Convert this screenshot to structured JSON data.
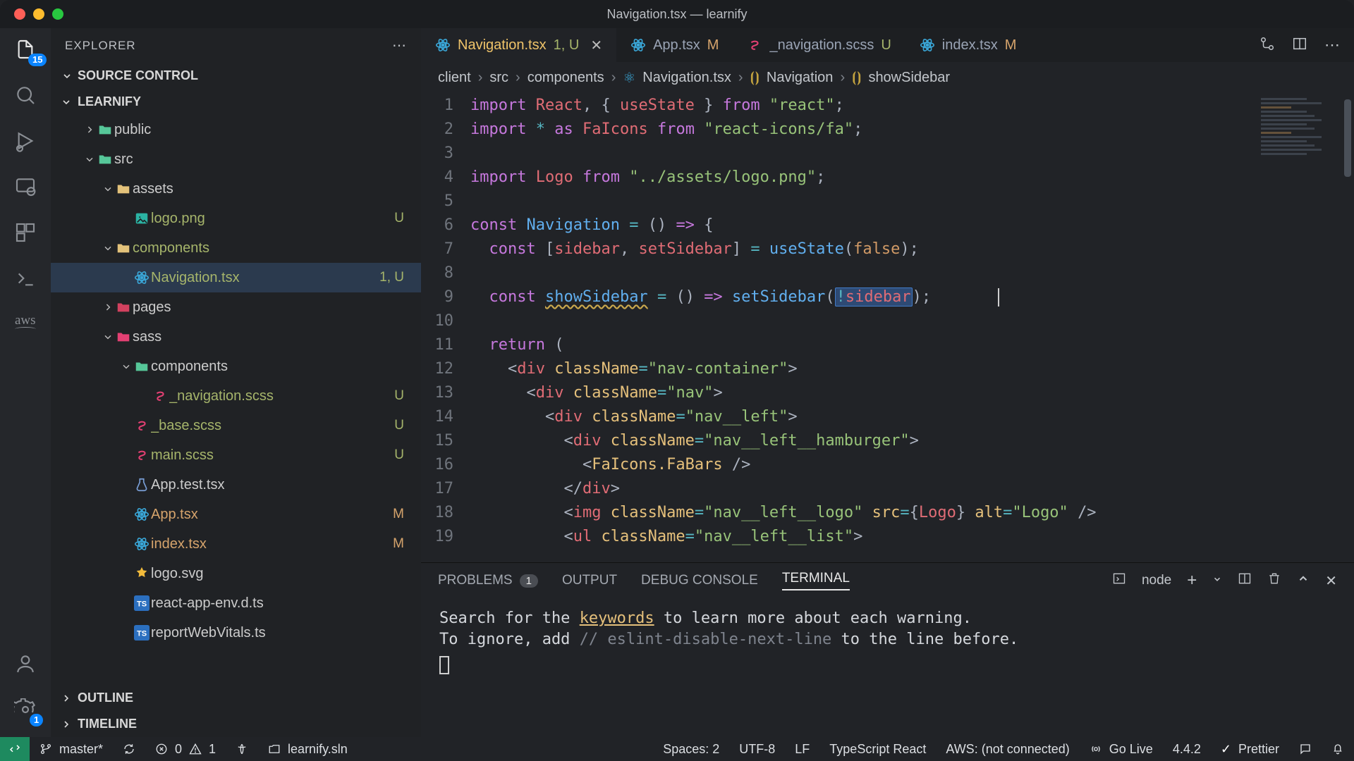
{
  "title": "Navigation.tsx — learnify",
  "activity_badge": "15",
  "settings_badge": "1",
  "explorer": {
    "header": "EXPLORER"
  },
  "sections": {
    "source_control": "SOURCE CONTROL",
    "project": "LEARNIFY",
    "outline": "OUTLINE",
    "timeline": "TIMELINE"
  },
  "tree": [
    {
      "indent": 1,
      "chev": "right",
      "lab": "public",
      "icon": "folder",
      "cls": "fi-mint",
      "stat": "dotM"
    },
    {
      "indent": 1,
      "chev": "down",
      "lab": "src",
      "icon": "folder",
      "cls": "fi-mint",
      "stat": "dotU"
    },
    {
      "indent": 2,
      "chev": "down",
      "lab": "assets",
      "icon": "folder",
      "cls": "fi-folder",
      "stat": ""
    },
    {
      "indent": 3,
      "chev": "",
      "lab": "logo.png",
      "icon": "img",
      "cls": "fi-img",
      "stat": "U",
      "txt": "gU"
    },
    {
      "indent": 2,
      "chev": "down",
      "lab": "components",
      "icon": "folder",
      "cls": "fi-folder",
      "stat": "dotU",
      "txt": "gU"
    },
    {
      "indent": 3,
      "chev": "",
      "lab": "Navigation.tsx",
      "icon": "react",
      "cls": "fi-react",
      "stat": "1, U",
      "sel": true,
      "txt": "gU"
    },
    {
      "indent": 2,
      "chev": "right",
      "lab": "pages",
      "icon": "folder",
      "cls": "fi-red",
      "stat": "dotU"
    },
    {
      "indent": 2,
      "chev": "down",
      "lab": "sass",
      "icon": "folder",
      "cls": "fi-scss",
      "stat": "dotU"
    },
    {
      "indent": 3,
      "chev": "down",
      "lab": "components",
      "icon": "folder",
      "cls": "fi-mint",
      "stat": "dotU"
    },
    {
      "indent": 4,
      "chev": "",
      "lab": "_navigation.scss",
      "icon": "scss",
      "cls": "fi-scss",
      "stat": "U",
      "txt": "gU"
    },
    {
      "indent": 3,
      "chev": "",
      "lab": "_base.scss",
      "icon": "scss",
      "cls": "fi-scss",
      "stat": "U",
      "txt": "gU"
    },
    {
      "indent": 3,
      "chev": "",
      "lab": "main.scss",
      "icon": "scss",
      "cls": "fi-scss",
      "stat": "U",
      "txt": "gU"
    },
    {
      "indent": 3,
      "chev": "",
      "lab": "App.test.tsx",
      "icon": "test",
      "cls": "fi-test",
      "stat": ""
    },
    {
      "indent": 3,
      "chev": "",
      "lab": "App.tsx",
      "icon": "react",
      "cls": "fi-react",
      "stat": "M",
      "txt": "gM"
    },
    {
      "indent": 3,
      "chev": "",
      "lab": "index.tsx",
      "icon": "react",
      "cls": "fi-react",
      "stat": "M",
      "txt": "gM"
    },
    {
      "indent": 3,
      "chev": "",
      "lab": "logo.svg",
      "icon": "svg",
      "cls": "fi-svg",
      "stat": ""
    },
    {
      "indent": 3,
      "chev": "",
      "lab": "react-app-env.d.ts",
      "icon": "ts",
      "cls": "fi-ts",
      "stat": ""
    },
    {
      "indent": 3,
      "chev": "",
      "lab": "reportWebVitals.ts",
      "icon": "ts",
      "cls": "fi-ts",
      "stat": ""
    }
  ],
  "tabs": [
    {
      "icon": "react",
      "cls": "fi-react",
      "lab": "Navigation.tsx",
      "suf": "1, U",
      "sufcls": "gU",
      "active": true,
      "close": true
    },
    {
      "icon": "react",
      "cls": "fi-react",
      "lab": "App.tsx",
      "suf": "M",
      "sufcls": "gM"
    },
    {
      "icon": "scss",
      "cls": "fi-scss",
      "lab": "_navigation.scss",
      "suf": "U",
      "sufcls": "gU"
    },
    {
      "icon": "react",
      "cls": "fi-react",
      "lab": "index.tsx",
      "suf": "M",
      "sufcls": "gM"
    }
  ],
  "breadcrumbs": [
    "client",
    "src",
    "components",
    "Navigation.tsx",
    "Navigation",
    "showSidebar"
  ],
  "code": {
    "lines": [
      {
        "n": 1,
        "h": "<span class='k'>import</span> <span class='id'>React</span><span class='pn'>, { </span><span class='id'>useState</span><span class='pn'> } </span><span class='k'>from</span> <span class='str'>\"react\"</span><span class='pn'>;</span>"
      },
      {
        "n": 2,
        "h": "<span class='k'>import</span> <span class='op'>*</span> <span class='k'>as</span> <span class='id'>FaIcons</span> <span class='k'>from</span> <span class='str'>\"react-icons/fa\"</span><span class='pn'>;</span>"
      },
      {
        "n": 3,
        "h": ""
      },
      {
        "n": 4,
        "h": "<span class='k'>import</span> <span class='id'>Logo</span> <span class='k'>from</span> <span class='str'>\"../assets/logo.png\"</span><span class='pn'>;</span>"
      },
      {
        "n": 5,
        "h": ""
      },
      {
        "n": 6,
        "h": "<span class='k'>const</span> <span class='fn'>Navigation</span> <span class='op'>=</span> <span class='pn'>() </span><span class='k'>=&gt;</span> <span class='pn'>{</span>"
      },
      {
        "n": 7,
        "h": "  <span class='k'>const</span> <span class='pn'>[</span><span class='id'>sidebar</span><span class='pn'>, </span><span class='id'>setSidebar</span><span class='pn'>] </span><span class='op'>=</span> <span class='fn'>useState</span><span class='pn'>(</span><span class='nm'>false</span><span class='pn'>);</span>"
      },
      {
        "n": 8,
        "h": ""
      },
      {
        "n": 9,
        "h": "  <span class='k'>const</span> <span class='fn underwav'>showSidebar</span> <span class='op'>=</span> <span class='pn'>() </span><span class='k'>=&gt;</span> <span class='fn'>setSidebar</span><span class='pn'>(</span><span class='selbox'><span class='op'>!</span><span class='id'>sidebar</span></span><span class='pn'>);</span>       <span class='cursor'></span>"
      },
      {
        "n": 10,
        "h": ""
      },
      {
        "n": 11,
        "h": "  <span class='k'>return</span> <span class='pn'>(</span>"
      },
      {
        "n": 12,
        "h": "    <span class='pn'>&lt;</span><span class='id'>div</span> <span class='ty'>className</span><span class='op'>=</span><span class='str'>\"nav-container\"</span><span class='pn'>&gt;</span>"
      },
      {
        "n": 13,
        "h": "      <span class='pn'>&lt;</span><span class='id'>div</span> <span class='ty'>className</span><span class='op'>=</span><span class='str'>\"nav\"</span><span class='pn'>&gt;</span>"
      },
      {
        "n": 14,
        "h": "        <span class='pn'>&lt;</span><span class='id'>div</span> <span class='ty'>className</span><span class='op'>=</span><span class='str'>\"nav__left\"</span><span class='pn'>&gt;</span>"
      },
      {
        "n": 15,
        "h": "          <span class='pn'>&lt;</span><span class='id'>div</span> <span class='ty'>className</span><span class='op'>=</span><span class='str'>\"nav__left__hamburger\"</span><span class='pn'>&gt;</span>"
      },
      {
        "n": 16,
        "h": "            <span class='pn'>&lt;</span><span class='ty'>FaIcons.FaBars</span> <span class='pn'>/&gt;</span>"
      },
      {
        "n": 17,
        "h": "          <span class='pn'>&lt;/</span><span class='id'>div</span><span class='pn'>&gt;</span>"
      },
      {
        "n": 18,
        "h": "          <span class='pn'>&lt;</span><span class='id'>img</span> <span class='ty'>className</span><span class='op'>=</span><span class='str'>\"nav__left__logo\"</span> <span class='ty'>src</span><span class='op'>=</span><span class='pn'>{</span><span class='id'>Logo</span><span class='pn'>}</span> <span class='ty'>alt</span><span class='op'>=</span><span class='str'>\"Logo\"</span> <span class='pn'>/&gt;</span>"
      },
      {
        "n": 19,
        "h": "          <span class='pn'>&lt;</span><span class='id'>ul</span> <span class='ty'>className</span><span class='op'>=</span><span class='str'>\"nav__left__list\"</span><span class='pn'>&gt;</span>"
      }
    ]
  },
  "panel": {
    "problems": "PROBLEMS",
    "problems_count": "1",
    "output": "OUTPUT",
    "debug": "DEBUG CONSOLE",
    "terminal": "TERMINAL",
    "shell": "node",
    "line1a": "Search for the ",
    "line1k": "keywords",
    "line1b": " to learn more about each warning.",
    "line2a": "To ignore, add ",
    "line2c": "// eslint-disable-next-line",
    "line2b": " to the line before."
  },
  "status": {
    "branch": "master*",
    "errors": "0",
    "warnings": "1",
    "sln": "learnify.sln",
    "spaces": "Spaces: 2",
    "enc": "UTF-8",
    "eol": "LF",
    "lang": "TypeScript React",
    "aws": "AWS: (not connected)",
    "golive": "Go Live",
    "ver": "4.4.2",
    "prettier": "Prettier"
  }
}
